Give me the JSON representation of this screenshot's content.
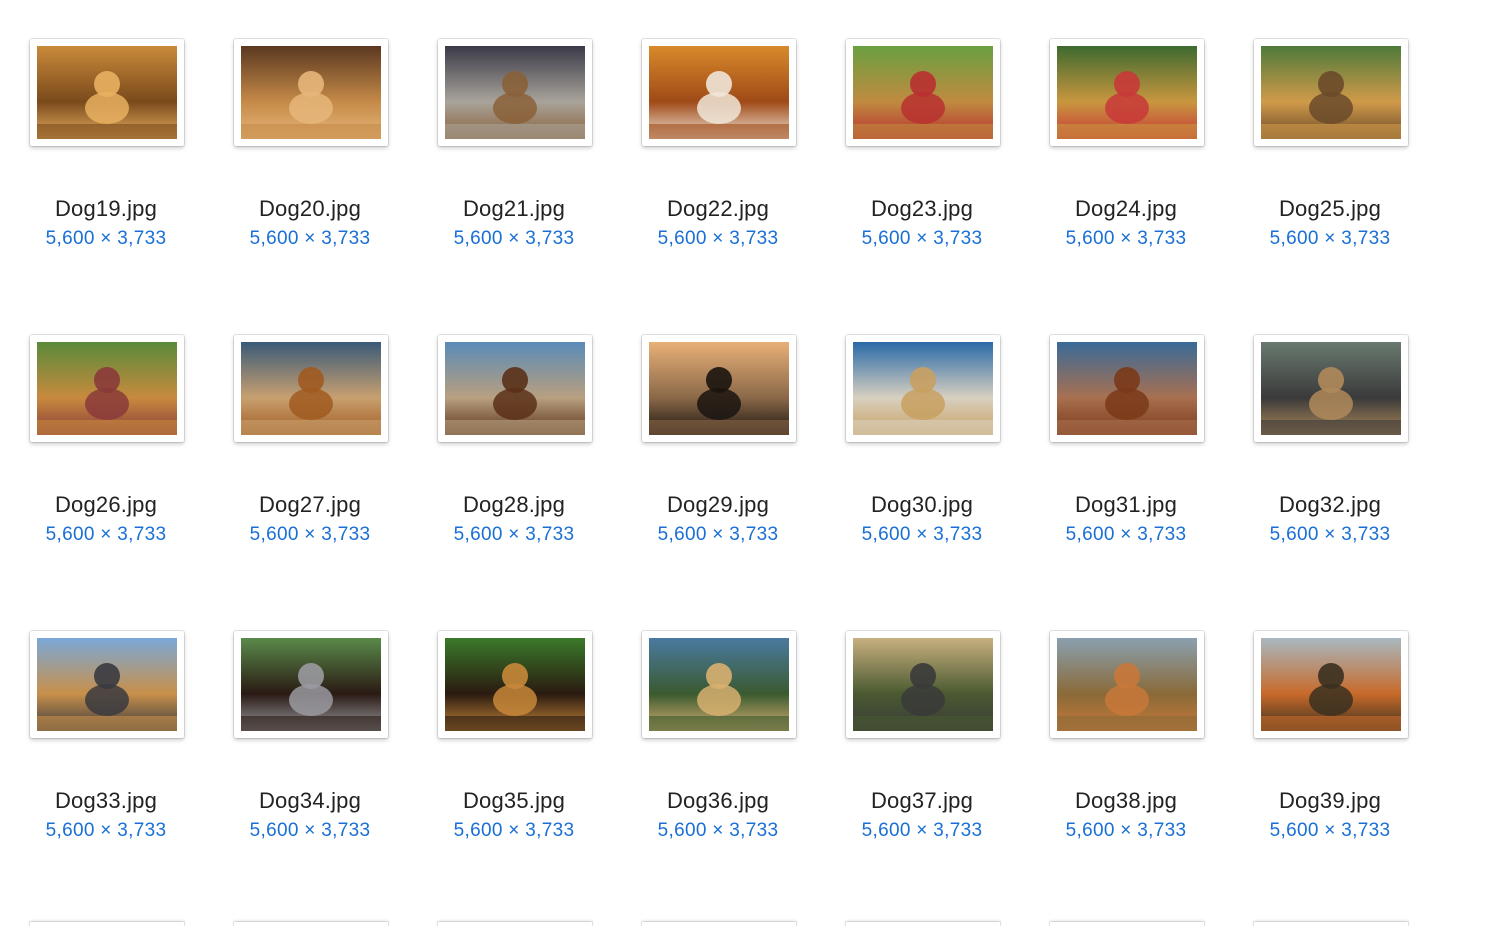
{
  "files": [
    {
      "name": "Dog19.jpg",
      "dims": "5,600 × 3,733",
      "icon": "image-thumbnail-icon",
      "colors": [
        "#c98a3a",
        "#7a4a1c",
        "#e8b060"
      ]
    },
    {
      "name": "Dog20.jpg",
      "dims": "5,600 × 3,733",
      "icon": "image-thumbnail-icon",
      "colors": [
        "#5a3820",
        "#c58a48",
        "#e6b67a"
      ]
    },
    {
      "name": "Dog21.jpg",
      "dims": "5,600 × 3,733",
      "icon": "image-thumbnail-icon",
      "colors": [
        "#3a3a48",
        "#a9a39a",
        "#8a6038"
      ]
    },
    {
      "name": "Dog22.jpg",
      "dims": "5,600 × 3,733",
      "icon": "image-thumbnail-icon",
      "colors": [
        "#d88a2a",
        "#a04a18",
        "#f0e6d8"
      ]
    },
    {
      "name": "Dog23.jpg",
      "dims": "5,600 × 3,733",
      "icon": "image-thumbnail-icon",
      "colors": [
        "#6aa040",
        "#c08a40",
        "#b83030"
      ]
    },
    {
      "name": "Dog24.jpg",
      "dims": "5,600 × 3,733",
      "icon": "image-thumbnail-icon",
      "colors": [
        "#3e6a30",
        "#c8963e",
        "#c83838"
      ]
    },
    {
      "name": "Dog25.jpg",
      "dims": "5,600 × 3,733",
      "icon": "image-thumbnail-icon",
      "colors": [
        "#4e7a3a",
        "#d09a4a",
        "#6a4a2a"
      ]
    },
    {
      "name": "Dog26.jpg",
      "dims": "5,600 × 3,733",
      "icon": "image-thumbnail-icon",
      "colors": [
        "#5a8a3a",
        "#c88a3e",
        "#8a3a3a"
      ]
    },
    {
      "name": "Dog27.jpg",
      "dims": "5,600 × 3,733",
      "icon": "image-thumbnail-icon",
      "colors": [
        "#3a5a78",
        "#c8a070",
        "#a05a20"
      ]
    },
    {
      "name": "Dog28.jpg",
      "dims": "5,600 × 3,733",
      "icon": "image-thumbnail-icon",
      "colors": [
        "#5a8ab8",
        "#b8a080",
        "#5a3018"
      ]
    },
    {
      "name": "Dog29.jpg",
      "dims": "5,600 × 3,733",
      "icon": "image-thumbnail-icon",
      "colors": [
        "#e8b078",
        "#8a6848",
        "#1a1410"
      ]
    },
    {
      "name": "Dog30.jpg",
      "dims": "5,600 × 3,733",
      "icon": "image-thumbnail-icon",
      "colors": [
        "#2a6aa8",
        "#d8d0c0",
        "#c8a060"
      ]
    },
    {
      "name": "Dog31.jpg",
      "dims": "5,600 × 3,733",
      "icon": "image-thumbnail-icon",
      "colors": [
        "#3a6a98",
        "#a87050",
        "#7a3818"
      ]
    },
    {
      "name": "Dog32.jpg",
      "dims": "5,600 × 3,733",
      "icon": "image-thumbnail-icon",
      "colors": [
        "#6a7a70",
        "#3a3a3a",
        "#b08a5a"
      ]
    },
    {
      "name": "Dog33.jpg",
      "dims": "5,600 × 3,733",
      "icon": "image-thumbnail-icon",
      "colors": [
        "#7aa8d8",
        "#c8904a",
        "#3a3a40"
      ]
    },
    {
      "name": "Dog34.jpg",
      "dims": "5,600 × 3,733",
      "icon": "image-thumbnail-icon",
      "colors": [
        "#5a8a4a",
        "#2a1a14",
        "#9a9aa0"
      ]
    },
    {
      "name": "Dog35.jpg",
      "dims": "5,600 × 3,733",
      "icon": "image-thumbnail-icon",
      "colors": [
        "#3a7a2a",
        "#2a1a10",
        "#c8883a"
      ]
    },
    {
      "name": "Dog36.jpg",
      "dims": "5,600 × 3,733",
      "icon": "image-thumbnail-icon",
      "colors": [
        "#4a7aa0",
        "#3a5a30",
        "#d8b070"
      ]
    },
    {
      "name": "Dog37.jpg",
      "dims": "5,600 × 3,733",
      "icon": "image-thumbnail-icon",
      "colors": [
        "#c8b080",
        "#4a5a30",
        "#3a3a3a"
      ]
    },
    {
      "name": "Dog38.jpg",
      "dims": "5,600 × 3,733",
      "icon": "image-thumbnail-icon",
      "colors": [
        "#8aa0b0",
        "#8a6a38",
        "#c8783a"
      ]
    },
    {
      "name": "Dog39.jpg",
      "dims": "5,600 × 3,733",
      "icon": "image-thumbnail-icon",
      "colors": [
        "#a8b8c0",
        "#c86a2a",
        "#3a3020"
      ]
    }
  ]
}
